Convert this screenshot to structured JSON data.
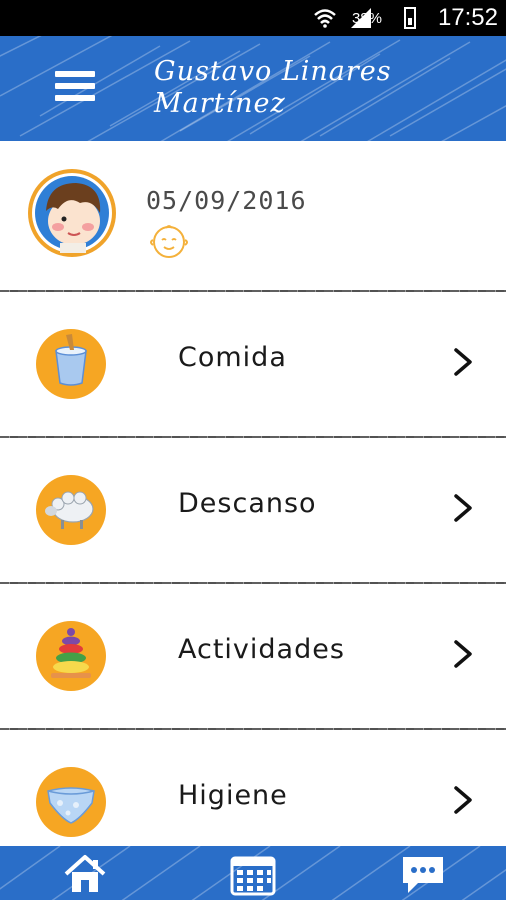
{
  "status_bar": {
    "battery": "38%",
    "time": "17:52"
  },
  "header": {
    "title_line1": "Gustavo Linares",
    "title_line2": "Martínez"
  },
  "profile": {
    "birth_date": "05/09/2016"
  },
  "menu": [
    {
      "label": "Comida",
      "icon": "yogurt-icon"
    },
    {
      "label": "Descanso",
      "icon": "sheep-icon"
    },
    {
      "label": "Actividades",
      "icon": "ring-stacker-icon"
    },
    {
      "label": "Higiene",
      "icon": "diaper-icon"
    }
  ],
  "bottom_nav": [
    "home-icon",
    "calendar-icon",
    "chat-icon"
  ],
  "colors": {
    "header_blue": "#2a6ec8",
    "icon_orange": "#f6a623",
    "status_black": "#000000"
  }
}
